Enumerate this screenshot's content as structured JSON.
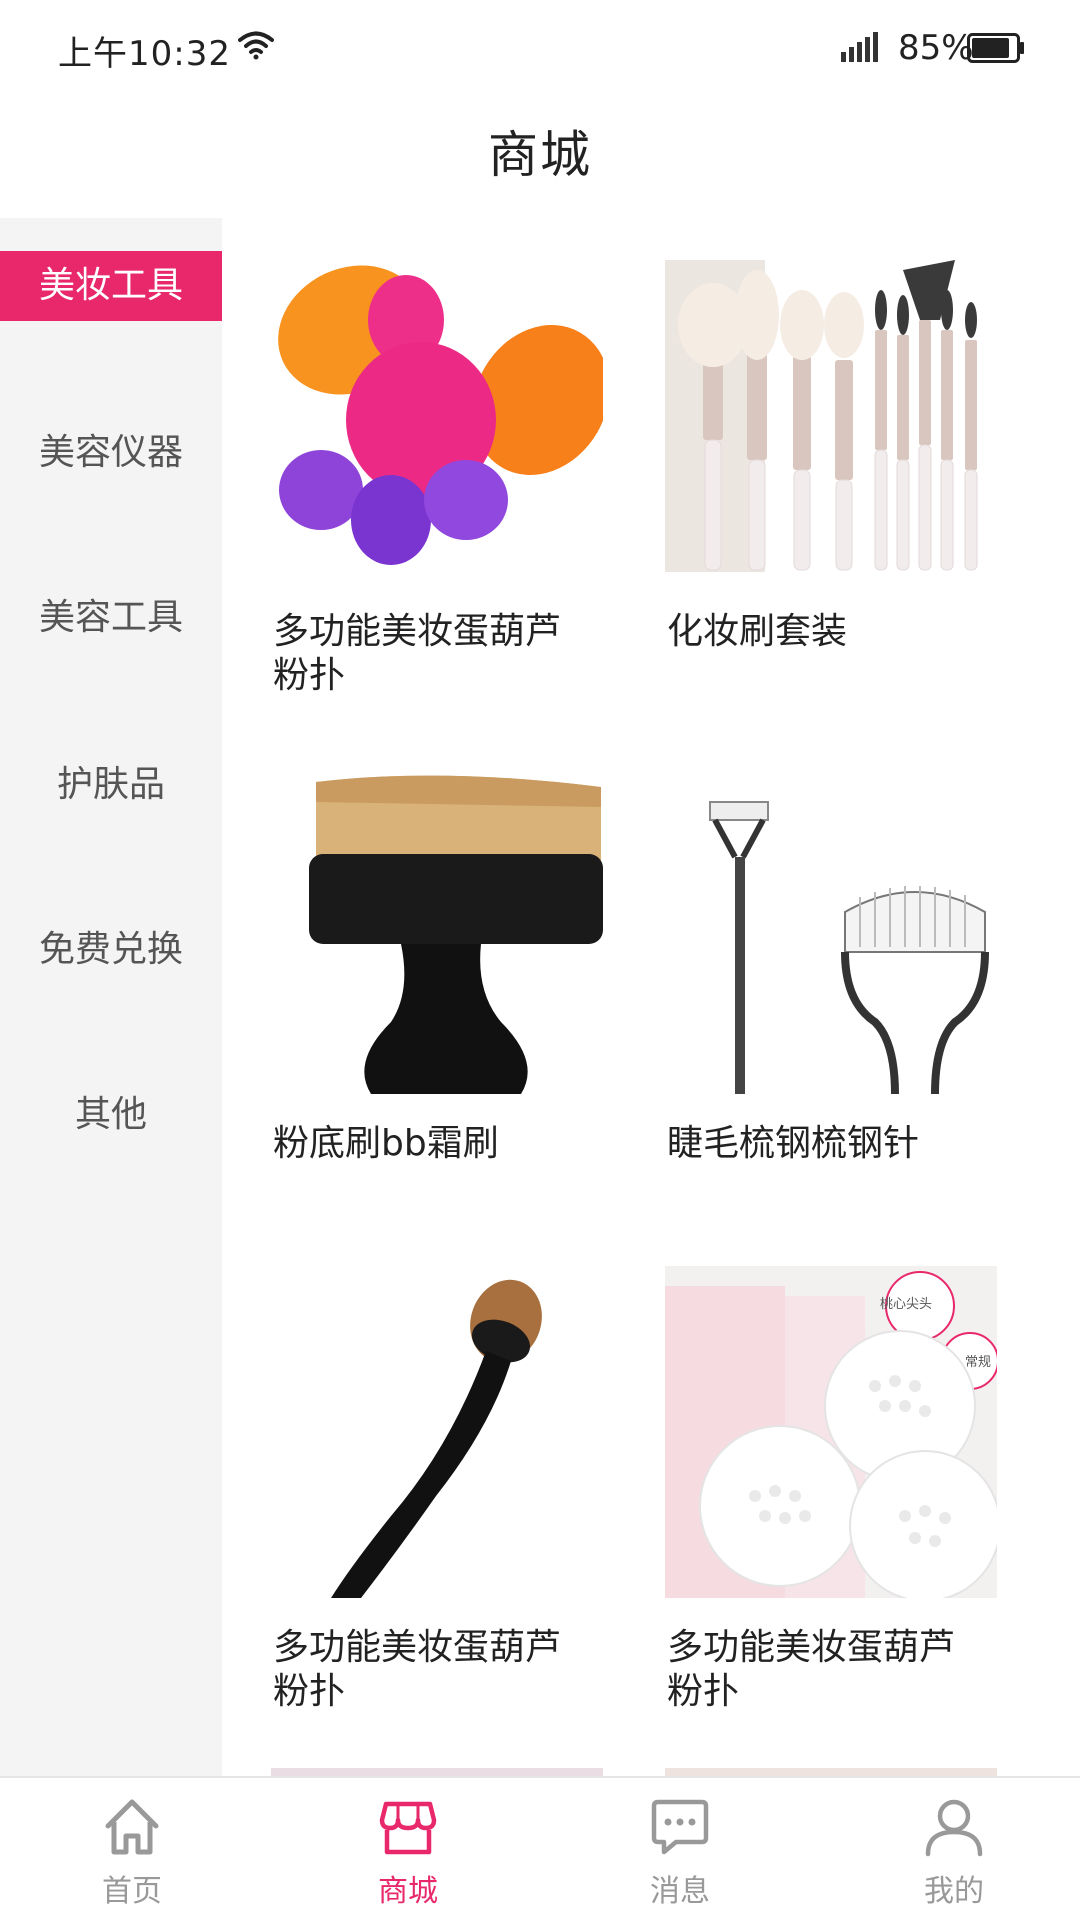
{
  "status_bar": {
    "time": "上午10:32",
    "battery_percent": "85%",
    "battery_level": 0.85
  },
  "header": {
    "title": "商城"
  },
  "sidebar": {
    "items": [
      {
        "label": "美妆工具",
        "active": true
      },
      {
        "label": "美容仪器",
        "active": false
      },
      {
        "label": "美容工具",
        "active": false
      },
      {
        "label": "护肤品",
        "active": false
      },
      {
        "label": "免费兑换",
        "active": false
      },
      {
        "label": "其他",
        "active": false
      }
    ]
  },
  "products": [
    {
      "name": "多功能美妆蛋葫芦粉扑",
      "image": "makeup-sponge-image"
    },
    {
      "name": "化妆刷套装",
      "image": "makeup-brush-set-image"
    },
    {
      "name": "粉底刷bb霜刷",
      "image": "foundation-brush-image"
    },
    {
      "name": "睫毛梳钢梳钢针",
      "image": "eyelash-comb-image"
    },
    {
      "name": "多功能美妆蛋葫芦粉扑",
      "image": "oval-brush-image"
    },
    {
      "name": "多功能美妆蛋葫芦粉扑",
      "image": "cotton-swabs-image",
      "overlay_texts": [
        "桃心尖头",
        "常规"
      ]
    }
  ],
  "tab_bar": {
    "tabs": [
      {
        "label": "首页",
        "icon": "home-icon",
        "active": false
      },
      {
        "label": "商城",
        "icon": "shop-icon",
        "active": true
      },
      {
        "label": "消息",
        "icon": "message-icon",
        "active": false
      },
      {
        "label": "我的",
        "icon": "user-icon",
        "active": false
      }
    ]
  },
  "colors": {
    "accent": "#e8286b",
    "sidebar_bg": "#f4f4f4",
    "inactive_tab": "#999999"
  }
}
